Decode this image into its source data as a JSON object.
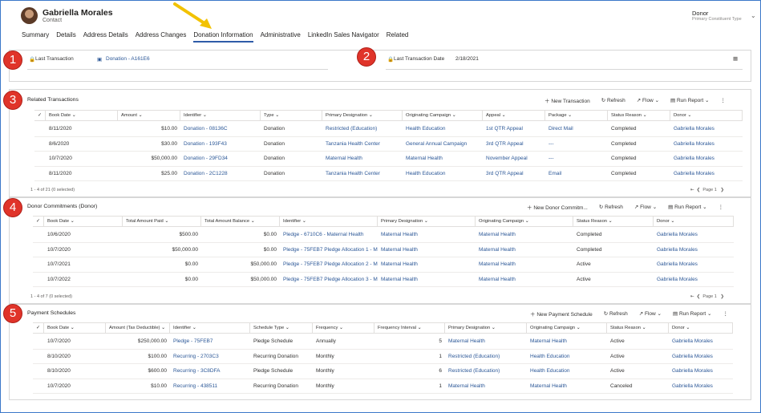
{
  "header": {
    "name": "Gabriella Morales",
    "entity": "Contact",
    "right_title": "Donor",
    "right_sub": "Primary Constituent Type"
  },
  "tabs": [
    "Summary",
    "Details",
    "Address Details",
    "Address Changes",
    "Donation Information",
    "Administrative",
    "LinkedIn Sales Navigator",
    "Related"
  ],
  "active_tab": "Donation Information",
  "badges": [
    "1",
    "2",
    "3",
    "4",
    "5"
  ],
  "last_transaction": {
    "label": "Last Transaction",
    "value": "Donation - A161E6"
  },
  "last_transaction_date": {
    "label": "Last Transaction Date",
    "value": "2/18/2021"
  },
  "related": {
    "title": "Related Transactions",
    "commands": [
      "New Transaction",
      "Refresh",
      "Flow",
      "Run Report"
    ],
    "columns": [
      "Book Date",
      "Amount",
      "Identifier",
      "Type",
      "Primary Designation",
      "Originating Campaign",
      "Appeal",
      "Package",
      "Status Reason",
      "Donor"
    ],
    "rows": [
      [
        "8/11/2020",
        "$10.00",
        "Donation - 08136C",
        "Donation",
        "Restricted (Education)",
        "Health Education",
        "1st QTR Appeal",
        "Direct Mail",
        "Completed",
        "Gabriella Morales"
      ],
      [
        "8/6/2020",
        "$30.00",
        "Donation - 193F43",
        "Donation",
        "Tanzania Health Center",
        "General Annual Campaign",
        "3rd QTR Appeal",
        "---",
        "Completed",
        "Gabriella Morales"
      ],
      [
        "10/7/2020",
        "$50,000.00",
        "Donation - 29FD34",
        "Donation",
        "Maternal Health",
        "Maternal Health",
        "November Appeal",
        "---",
        "Completed",
        "Gabriella Morales"
      ],
      [
        "8/11/2020",
        "$25.00",
        "Donation - 2C1228",
        "Donation",
        "Tanzania Health Center",
        "Health Education",
        "3rd QTR Appeal",
        "Email",
        "Completed",
        "Gabriella Morales"
      ]
    ],
    "footer": "1 - 4 of 21 (0 selected)",
    "page": "Page 1"
  },
  "commitments": {
    "title": "Donor Commitments (Donor)",
    "commands": [
      "New Donor Commitm...",
      "Refresh",
      "Flow",
      "Run Report"
    ],
    "columns": [
      "Book Date",
      "Total Amount Paid",
      "Total Amount Balance",
      "Identifier",
      "Primary Designation",
      "Originating Campaign",
      "Status Reason",
      "Donor"
    ],
    "rows": [
      [
        "10/6/2020",
        "$500.00",
        "$0.00",
        "Pledge - 6710C6 - Maternal Health",
        "Maternal Health",
        "Maternal Health",
        "Completed",
        "Gabriella Morales"
      ],
      [
        "10/7/2020",
        "$50,000.00",
        "$0.00",
        "Pledge - 75FEB7 Pledge Allocation 1 - Ma",
        "Maternal Health",
        "Maternal Health",
        "Completed",
        "Gabriella Morales"
      ],
      [
        "10/7/2021",
        "$0.00",
        "$50,000.00",
        "Pledge - 75FEB7 Pledge Allocation 2 - Ma",
        "Maternal Health",
        "Maternal Health",
        "Active",
        "Gabriella Morales"
      ],
      [
        "10/7/2022",
        "$0.00",
        "$50,000.00",
        "Pledge - 75FEB7 Pledge Allocation 3 - Ma",
        "Maternal Health",
        "Maternal Health",
        "Active",
        "Gabriella Morales"
      ]
    ],
    "footer": "1 - 4 of 7 (0 selected)",
    "page": "Page 1"
  },
  "schedules": {
    "title": "Payment Schedules",
    "commands": [
      "New Payment Schedule",
      "Refresh",
      "Flow",
      "Run Report"
    ],
    "columns": [
      "Book Date",
      "Amount (Tax Deductible)",
      "Identifier",
      "Schedule Type",
      "Frequency",
      "Frequency Interval",
      "Primary Designation",
      "Originating Campaign",
      "Status Reason",
      "Donor"
    ],
    "rows": [
      [
        "10/7/2020",
        "$250,000.00",
        "Pledge - 75FEB7",
        "Pledge Schedule",
        "Annually",
        "5",
        "Maternal Health",
        "Maternal Health",
        "Active",
        "Gabriella Morales"
      ],
      [
        "8/10/2020",
        "$100.00",
        "Recurring - 2703C3",
        "Recurring Donation",
        "Monthly",
        "1",
        "Restricted (Education)",
        "Health Education",
        "Active",
        "Gabriella Morales"
      ],
      [
        "8/10/2020",
        "$600.00",
        "Recurring - 3C8DFA",
        "Pledge Schedule",
        "Monthly",
        "6",
        "Restricted (Education)",
        "Health Education",
        "Active",
        "Gabriella Morales"
      ],
      [
        "10/7/2020",
        "$10.00",
        "Recurring - 438511",
        "Recurring Donation",
        "Monthly",
        "1",
        "Maternal Health",
        "Maternal Health",
        "Canceled",
        "Gabriella Morales"
      ]
    ]
  }
}
